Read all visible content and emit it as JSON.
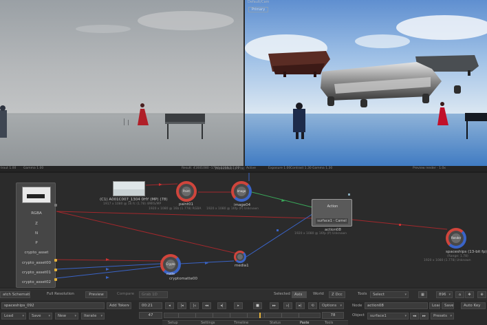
{
  "viewer_left": {
    "status_left": "trout 1.00",
    "status_gamma": "Gamma 1.00",
    "status_right": "Result: 41601080 -1794x1008 1:1.00"
  },
  "viewer_right": {
    "header_label": "Default/Cam",
    "tab": "Primary",
    "status_active": "Active",
    "status_exposure": "Exposure 1.00",
    "status_contrast": "Contrast 1.30",
    "status_gamma": "Gamma 1.30",
    "status_right": "Preview render · 1.0x",
    "status_center": "1920x1080 (1.778)"
  },
  "nodes": {
    "loader": {
      "ports": [
        "RGBA",
        "Z",
        "N",
        "P",
        "crypto_asset",
        "crypto_asset00",
        "crypto_asset01",
        "crypto_asset02"
      ]
    },
    "image_thumb": {
      "name": "(C1) A001C007_1304 0HY (MP) (78)",
      "info": "1917 x 1080 @ 16 fc (1.78) 4MRS/MP"
    },
    "paint": {
      "name": "paint01",
      "label": "Paint",
      "info": "1920 x 1080 @ 16b (1.778) RGBA"
    },
    "image": {
      "name": "image04",
      "label": "Image",
      "info": "1920 x 1080 @ 16fp (P) Unknown"
    },
    "action": {
      "name": "action08",
      "label": "Action",
      "sub": "surface1 - Camel",
      "info": "1920 x 1080 @ 16fp (P) Unknown"
    },
    "crypto": {
      "name": "cryptomatte00",
      "label": "Crypto matte"
    },
    "media": {
      "name": "media1"
    },
    "render": {
      "name": "spaceships (13-bit fp)",
      "label": "Render",
      "info1": "(Range: 1.78)",
      "info2": "1920 x 1080 (1.778) Unknown"
    }
  },
  "toolbar1": {
    "schematic": "atch Schematic",
    "full_res": "Full Resolution",
    "preview": "Preview",
    "compare": "Compare",
    "grab": "Grab 1D",
    "selected_label": "Selected",
    "selected_value": "Axis",
    "world": "World",
    "zdcc": "Z Dcc",
    "tools_label": "Tools",
    "select_value": "Select",
    "zoom_value": "896"
  },
  "toolbar2": {
    "clip_name": "spaceships_092",
    "add_token": "Add Token",
    "load": "Load",
    "save": "Save",
    "new": "New",
    "iterate": "Iterate",
    "timecode": "00:21",
    "frame": "47",
    "end_frame": "78",
    "options": "Options",
    "node_label": "Node",
    "node_value": "action08",
    "node_load": "Load",
    "node_save": "Save",
    "object_label": "Object",
    "object_value": "surface1",
    "presets": "Presets",
    "autokey": "Auto Key",
    "tabs": [
      "Setup",
      "Settings",
      "Timeline",
      "Status",
      "Paste",
      "Tools"
    ]
  },
  "colors": {
    "accent_yellow": "#e5b23a",
    "wire_red": "#a3282c",
    "wire_blue": "#3a64c8",
    "wire_green": "#3aa85a",
    "node_red": "#d0453c"
  }
}
